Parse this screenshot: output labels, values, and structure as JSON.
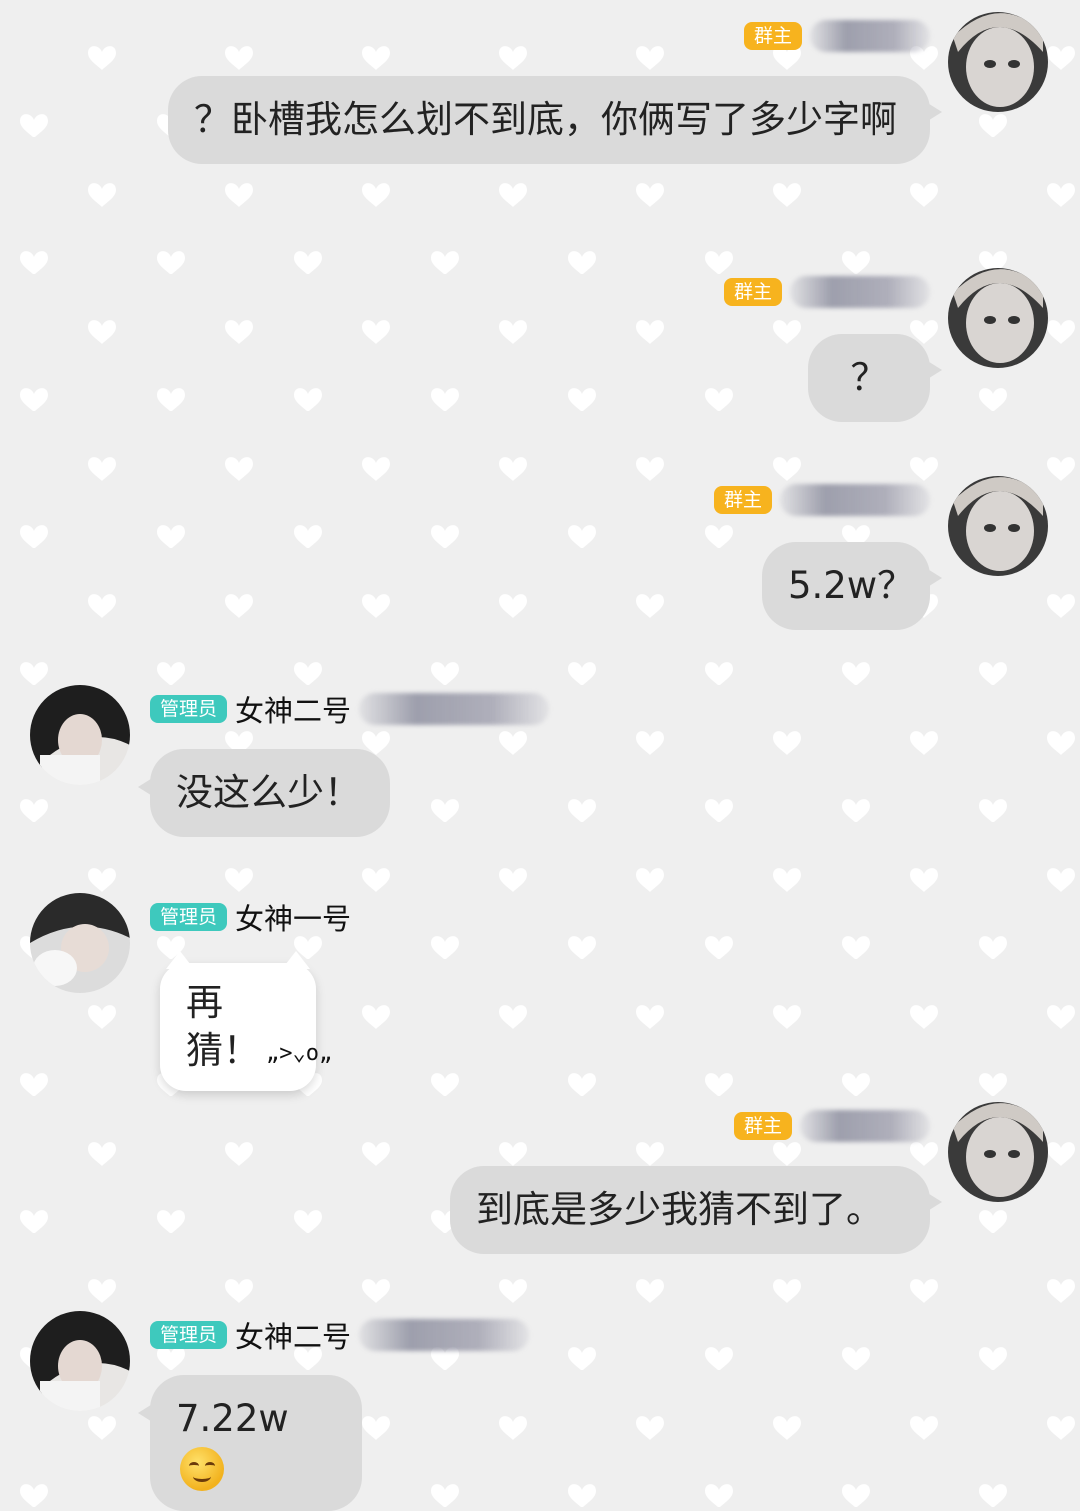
{
  "messages": [
    {
      "side": "right",
      "role": "owner",
      "badge": "群主",
      "name": "",
      "text": "？卧槽我怎么划不到底，你俩写了多少字啊"
    },
    {
      "side": "right",
      "role": "owner",
      "badge": "群主",
      "name": "",
      "text": "？"
    },
    {
      "side": "right",
      "role": "owner",
      "badge": "群主",
      "name": "",
      "text": "5.2w？"
    },
    {
      "side": "left",
      "role": "admin",
      "badge": "管理员",
      "name": "女神二号",
      "text": "没这么少！"
    },
    {
      "side": "left",
      "role": "admin",
      "badge": "管理员",
      "name": "女神一号",
      "text": "再猜！",
      "kaomoji": "„>⌄o„"
    },
    {
      "side": "right",
      "role": "owner",
      "badge": "群主",
      "name": "",
      "text": "到底是多少我猜不到了。"
    },
    {
      "side": "left",
      "role": "admin",
      "badge": "管理员",
      "name": "女神二号",
      "text": "7.22w",
      "emoji": "smiling-face-icon"
    }
  ],
  "colors": {
    "background": "#efefef",
    "bubble": "#dadada",
    "owner_badge": "#f7b31e",
    "admin_badge": "#3ec9bd"
  }
}
